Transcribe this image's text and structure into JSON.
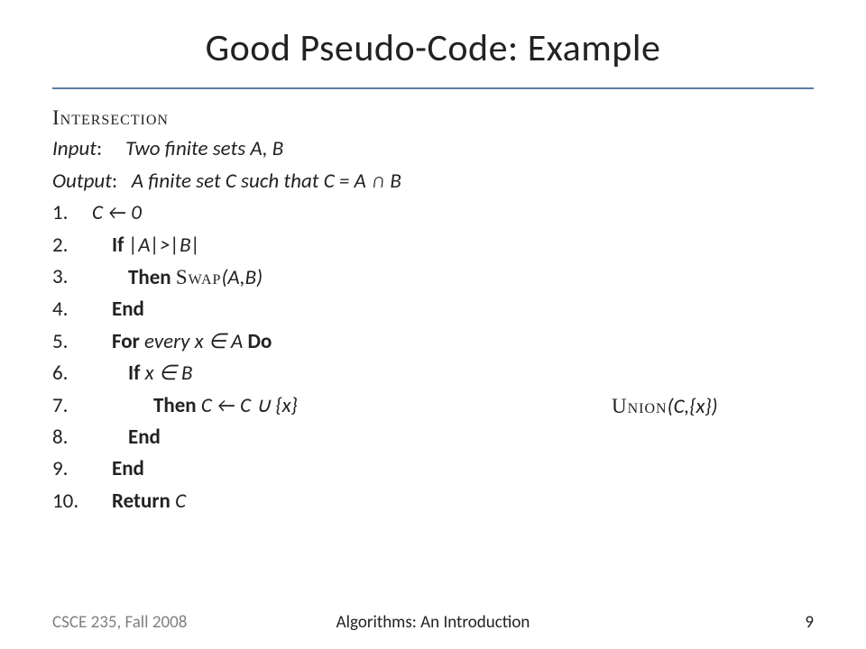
{
  "title": "Good Pseudo-Code: Example",
  "algoName": "Intersection",
  "inputLabel": "Input",
  "inputValue": "Two finite sets A, B",
  "outputLabel": "Output",
  "outputValue": "A finite set C such that C = A ∩ B",
  "lines": {
    "l1": "C ← 0",
    "l2a": "If",
    "l2b": "|A|>|B|",
    "l3a": "Then",
    "l3b": "Swap",
    "l3c": "(A,B)",
    "l4": "End",
    "l5a": "For",
    "l5b": "every x ∈ A",
    "l5c": "Do",
    "l6a": "If",
    "l6b": "x ∈ B",
    "l7a": "Then",
    "l7b": "C ← C ∪ {x}",
    "l7ann": "Union",
    "l7annargs": "(C,{x})",
    "l8": "End",
    "l9": "End",
    "l10a": "Return",
    "l10b": "C"
  },
  "footer": {
    "left": "CSCE 235, Fall 2008",
    "center": "Algorithms: An Introduction",
    "page": "9"
  }
}
